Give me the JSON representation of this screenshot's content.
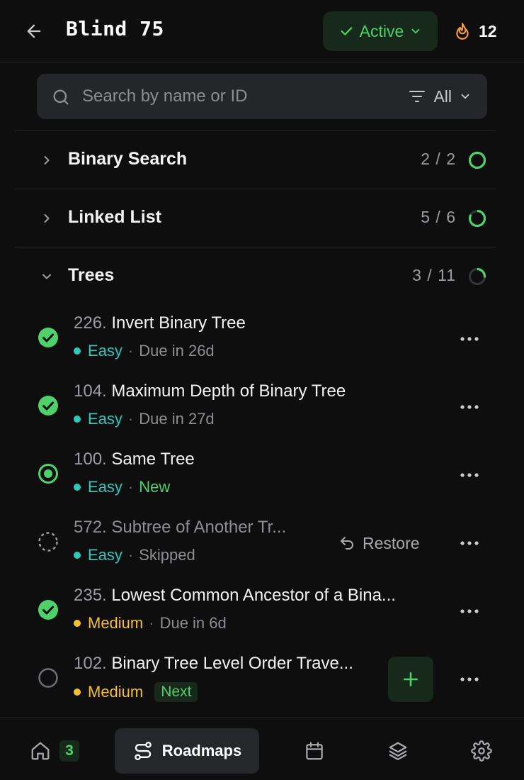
{
  "header": {
    "title": "Blind 75",
    "status": "Active",
    "streak": "12"
  },
  "search": {
    "placeholder": "Search by name or ID",
    "filter_label": "All"
  },
  "sections": [
    {
      "name": "Binary Search",
      "count": "2 / 2",
      "expanded": false,
      "progress": 1.0
    },
    {
      "name": "Linked List",
      "count": "5 / 6",
      "expanded": false,
      "progress": 0.83
    },
    {
      "name": "Trees",
      "count": "3 / 11",
      "expanded": true,
      "progress": 0.27
    }
  ],
  "problems": [
    {
      "number": "226.",
      "title": "Invert Binary Tree",
      "difficulty": "Easy",
      "sep": "·",
      "detail": "Due in 26d",
      "state": "done"
    },
    {
      "number": "104.",
      "title": "Maximum Depth of Binary Tree",
      "difficulty": "Easy",
      "sep": "·",
      "detail": "Due in 27d",
      "state": "done"
    },
    {
      "number": "100.",
      "title": "Same Tree",
      "difficulty": "Easy",
      "sep": "·",
      "detail": "New",
      "state": "in-progress"
    },
    {
      "number": "572.",
      "title": "Subtree of Another Tr...",
      "difficulty": "Easy",
      "sep": "·",
      "detail": "Skipped",
      "state": "skipped",
      "action": "Restore"
    },
    {
      "number": "235.",
      "title": "Lowest Common Ancestor of a Bina...",
      "difficulty": "Medium",
      "sep": "·",
      "detail": "Due in 6d",
      "state": "done"
    },
    {
      "number": "102.",
      "title": "Binary Tree Level Order Trave...",
      "difficulty": "Medium",
      "badge": "Next",
      "state": "todo"
    }
  ],
  "bottom_nav": {
    "home_badge": "3",
    "roadmaps_label": "Roadmaps"
  },
  "colors": {
    "accent_green": "#4ed06a",
    "easy": "#2fc8b9",
    "medium": "#f5bf30",
    "background": "#0e0e0f"
  }
}
